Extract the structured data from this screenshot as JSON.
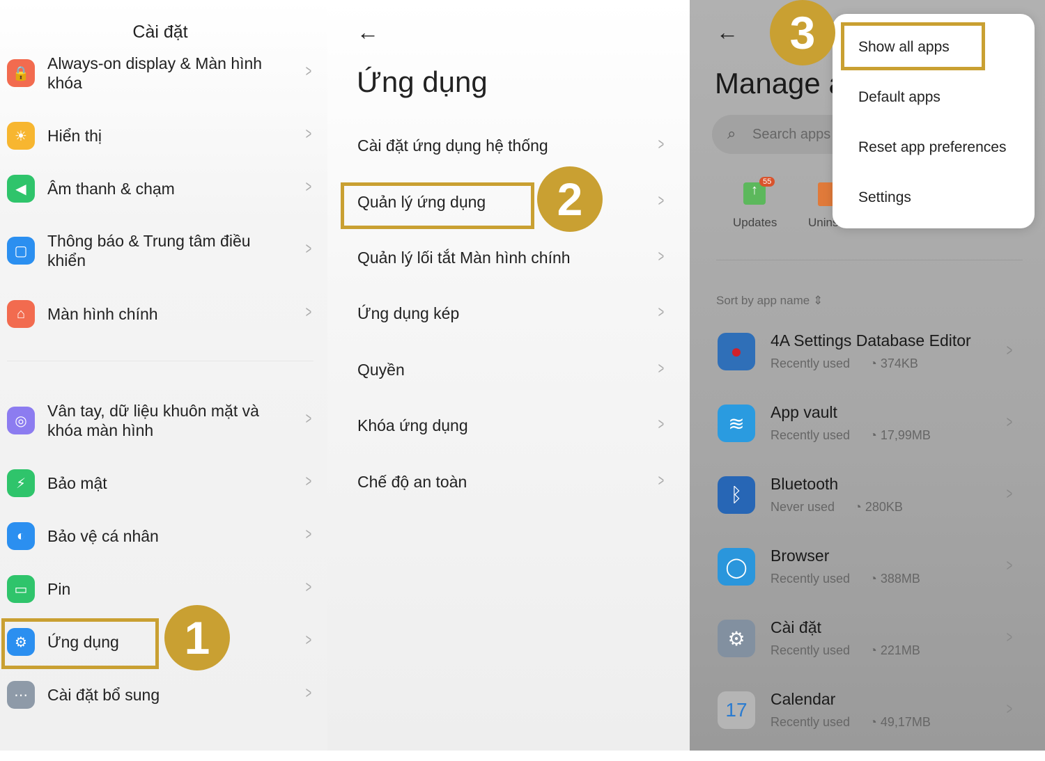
{
  "colors": {
    "highlight": "#c9a032",
    "badge_text": "#ffffff"
  },
  "panel1": {
    "title": "Cài đặt",
    "items": [
      {
        "label": "Always-on display & Màn hình khóa",
        "icon": "lock-icon",
        "color": "#f26b4f"
      },
      {
        "label": "Hiển thị",
        "icon": "sun-icon",
        "color": "#f7b630"
      },
      {
        "label": "Âm thanh & chạm",
        "icon": "speaker-icon",
        "color": "#2fc46b"
      },
      {
        "label": "Thông báo & Trung tâm điều khiển",
        "icon": "notification-icon",
        "color": "#2b8ff0"
      },
      {
        "label": "Màn hình chính",
        "icon": "home-icon",
        "color": "#f26b4f"
      },
      {
        "label": "Vân tay, dữ liệu khuôn mặt và khóa màn hình",
        "icon": "fingerprint-icon",
        "color": "#8c7cf0"
      },
      {
        "label": "Bảo mật",
        "icon": "shield-icon",
        "color": "#2fc46b"
      },
      {
        "label": "Bảo vệ cá nhân",
        "icon": "privacy-icon",
        "color": "#2b8ff0"
      },
      {
        "label": "Pin",
        "icon": "battery-icon",
        "color": "#2fc46b"
      },
      {
        "label": "Ứng dụng",
        "icon": "gear-icon",
        "color": "#2b8ff0"
      },
      {
        "label": "Cài đặt bổ sung",
        "icon": "more-icon",
        "color": "#8e9aa8"
      }
    ],
    "step": "1"
  },
  "panel2": {
    "title": "Ứng dụng",
    "items": [
      "Cài đặt ứng dụng hệ thống",
      "Quản lý ứng dụng",
      "Quản lý lối tắt Màn hình chính",
      "Ứng dụng kép",
      "Quyền",
      "Khóa ứng dụng",
      "Chế độ an toàn"
    ],
    "step": "2"
  },
  "panel3": {
    "title": "Manage a",
    "search_placeholder": "Search apps",
    "shortcuts": [
      {
        "label": "Updates",
        "badge": "55"
      },
      {
        "label": "Unins"
      }
    ],
    "sort_label": "Sort by app name",
    "menu": [
      "Show all apps",
      "Default apps",
      "Reset app preferences",
      "Settings"
    ],
    "step": "3",
    "apps": [
      {
        "name": "4A Settings Database Editor",
        "usage": "Recently used",
        "size": "374KB",
        "icon": "settings-db-icon"
      },
      {
        "name": "App vault",
        "usage": "Recently used",
        "size": "17,99MB",
        "icon": "layers-icon"
      },
      {
        "name": "Bluetooth",
        "usage": "Never used",
        "size": "280KB",
        "icon": "bluetooth-icon"
      },
      {
        "name": "Browser",
        "usage": "Recently used",
        "size": "388MB",
        "icon": "browser-icon"
      },
      {
        "name": "Cài đặt",
        "usage": "Recently used",
        "size": "221MB",
        "icon": "gear-icon"
      },
      {
        "name": "Calendar",
        "usage": "Recently used",
        "size": "49,17MB",
        "icon": "calendar-icon",
        "day": "17"
      }
    ]
  }
}
